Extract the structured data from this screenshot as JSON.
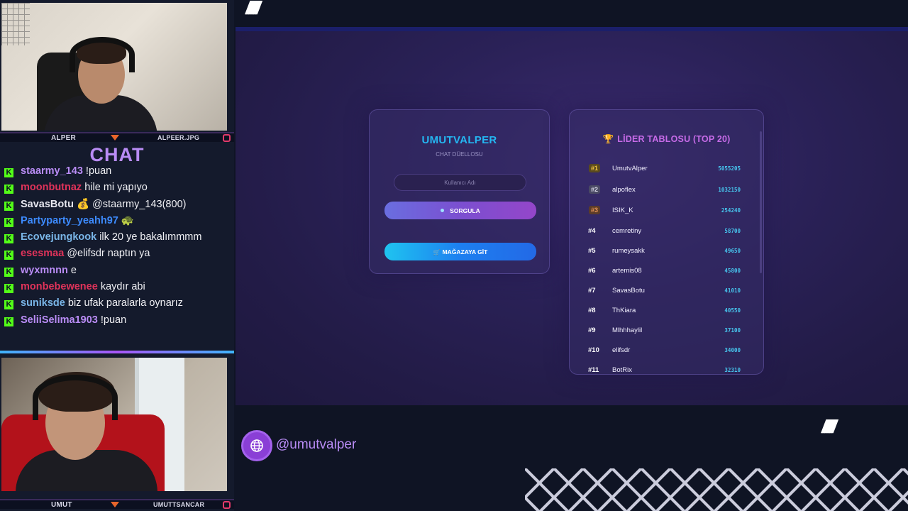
{
  "cams": {
    "top": {
      "left_name": "ALPER",
      "right_name": "ALPEER.JPG"
    },
    "bottom": {
      "left_name": "UMUT",
      "right_name": "UMUTTSANCAR"
    }
  },
  "chat": {
    "title": "CHAT",
    "messages": [
      {
        "user": "staarmy_143",
        "color": "#b98cf5",
        "text": "!puan"
      },
      {
        "user": "moonbutnaz",
        "color": "#e0335a",
        "text": "hile mi yapıyo"
      },
      {
        "user": "SavasBotu",
        "color": "#e6e6ee",
        "text": "💰 @staarmy_143(800)"
      },
      {
        "user": "Partyparty_yeahh97",
        "color": "#3d8bff",
        "text": "🐢"
      },
      {
        "user": "Ecovejungkook",
        "color": "#7ab6e8",
        "text": "ilk 20 ye bakalımmmm"
      },
      {
        "user": "esesmaa",
        "color": "#e0335a",
        "text": "@elifsdr naptın ya"
      },
      {
        "user": "wyxmnnn",
        "color": "#b98cf5",
        "text": "e"
      },
      {
        "user": "monbebewenee",
        "color": "#e0335a",
        "text": "kaydır abi"
      },
      {
        "user": "suniksde",
        "color": "#7ab6e8",
        "text": "biz ufak paralarla oynarız"
      },
      {
        "user": "SeliiSelima1903",
        "color": "#b98cf5",
        "text": "!puan"
      }
    ]
  },
  "login": {
    "title": "UMUTVALPER",
    "subtitle": "CHAT DÜELLOSU",
    "username_placeholder": "Kullanıcı Adı",
    "query_button": "SORGULA",
    "shop_button": "MAĞAZAYA GİT"
  },
  "leaderboard": {
    "title": "LİDER TABLOSU (TOP 20)",
    "rows": [
      {
        "rank": "#1",
        "name": "UmutvAlper",
        "score": "5055205"
      },
      {
        "rank": "#2",
        "name": "alpoflex",
        "score": "1032150"
      },
      {
        "rank": "#3",
        "name": "ISIK_K",
        "score": "254240"
      },
      {
        "rank": "#4",
        "name": "cemretiny",
        "score": "58700"
      },
      {
        "rank": "#5",
        "name": "rumeysakk",
        "score": "49650"
      },
      {
        "rank": "#6",
        "name": "artemis08",
        "score": "45800"
      },
      {
        "rank": "#7",
        "name": "SavasBotu",
        "score": "41010"
      },
      {
        "rank": "#8",
        "name": "ThKiara",
        "score": "40550"
      },
      {
        "rank": "#9",
        "name": "Mlhhhaylil",
        "score": "37100"
      },
      {
        "rank": "#10",
        "name": "elifsdr",
        "score": "34000"
      },
      {
        "rank": "#11",
        "name": "BotRix",
        "score": "32310"
      }
    ]
  },
  "social": {
    "handle": "@umutvalper"
  }
}
